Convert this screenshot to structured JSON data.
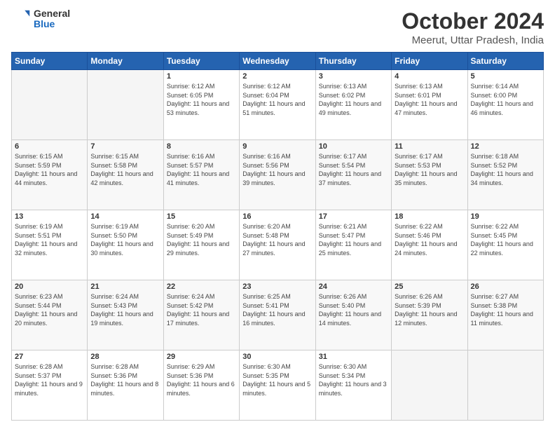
{
  "logo": {
    "general": "General",
    "blue": "Blue"
  },
  "title": "October 2024",
  "subtitle": "Meerut, Uttar Pradesh, India",
  "days_header": [
    "Sunday",
    "Monday",
    "Tuesday",
    "Wednesday",
    "Thursday",
    "Friday",
    "Saturday"
  ],
  "weeks": [
    [
      {
        "day": "",
        "sunrise": "",
        "sunset": "",
        "daylight": ""
      },
      {
        "day": "",
        "sunrise": "",
        "sunset": "",
        "daylight": ""
      },
      {
        "day": "1",
        "sunrise": "6:12 AM",
        "sunset": "6:05 PM",
        "daylight": "11 hours and 53 minutes."
      },
      {
        "day": "2",
        "sunrise": "6:12 AM",
        "sunset": "6:04 PM",
        "daylight": "11 hours and 51 minutes."
      },
      {
        "day": "3",
        "sunrise": "6:13 AM",
        "sunset": "6:02 PM",
        "daylight": "11 hours and 49 minutes."
      },
      {
        "day": "4",
        "sunrise": "6:13 AM",
        "sunset": "6:01 PM",
        "daylight": "11 hours and 47 minutes."
      },
      {
        "day": "5",
        "sunrise": "6:14 AM",
        "sunset": "6:00 PM",
        "daylight": "11 hours and 46 minutes."
      }
    ],
    [
      {
        "day": "6",
        "sunrise": "6:15 AM",
        "sunset": "5:59 PM",
        "daylight": "11 hours and 44 minutes."
      },
      {
        "day": "7",
        "sunrise": "6:15 AM",
        "sunset": "5:58 PM",
        "daylight": "11 hours and 42 minutes."
      },
      {
        "day": "8",
        "sunrise": "6:16 AM",
        "sunset": "5:57 PM",
        "daylight": "11 hours and 41 minutes."
      },
      {
        "day": "9",
        "sunrise": "6:16 AM",
        "sunset": "5:56 PM",
        "daylight": "11 hours and 39 minutes."
      },
      {
        "day": "10",
        "sunrise": "6:17 AM",
        "sunset": "5:54 PM",
        "daylight": "11 hours and 37 minutes."
      },
      {
        "day": "11",
        "sunrise": "6:17 AM",
        "sunset": "5:53 PM",
        "daylight": "11 hours and 35 minutes."
      },
      {
        "day": "12",
        "sunrise": "6:18 AM",
        "sunset": "5:52 PM",
        "daylight": "11 hours and 34 minutes."
      }
    ],
    [
      {
        "day": "13",
        "sunrise": "6:19 AM",
        "sunset": "5:51 PM",
        "daylight": "11 hours and 32 minutes."
      },
      {
        "day": "14",
        "sunrise": "6:19 AM",
        "sunset": "5:50 PM",
        "daylight": "11 hours and 30 minutes."
      },
      {
        "day": "15",
        "sunrise": "6:20 AM",
        "sunset": "5:49 PM",
        "daylight": "11 hours and 29 minutes."
      },
      {
        "day": "16",
        "sunrise": "6:20 AM",
        "sunset": "5:48 PM",
        "daylight": "11 hours and 27 minutes."
      },
      {
        "day": "17",
        "sunrise": "6:21 AM",
        "sunset": "5:47 PM",
        "daylight": "11 hours and 25 minutes."
      },
      {
        "day": "18",
        "sunrise": "6:22 AM",
        "sunset": "5:46 PM",
        "daylight": "11 hours and 24 minutes."
      },
      {
        "day": "19",
        "sunrise": "6:22 AM",
        "sunset": "5:45 PM",
        "daylight": "11 hours and 22 minutes."
      }
    ],
    [
      {
        "day": "20",
        "sunrise": "6:23 AM",
        "sunset": "5:44 PM",
        "daylight": "11 hours and 20 minutes."
      },
      {
        "day": "21",
        "sunrise": "6:24 AM",
        "sunset": "5:43 PM",
        "daylight": "11 hours and 19 minutes."
      },
      {
        "day": "22",
        "sunrise": "6:24 AM",
        "sunset": "5:42 PM",
        "daylight": "11 hours and 17 minutes."
      },
      {
        "day": "23",
        "sunrise": "6:25 AM",
        "sunset": "5:41 PM",
        "daylight": "11 hours and 16 minutes."
      },
      {
        "day": "24",
        "sunrise": "6:26 AM",
        "sunset": "5:40 PM",
        "daylight": "11 hours and 14 minutes."
      },
      {
        "day": "25",
        "sunrise": "6:26 AM",
        "sunset": "5:39 PM",
        "daylight": "11 hours and 12 minutes."
      },
      {
        "day": "26",
        "sunrise": "6:27 AM",
        "sunset": "5:38 PM",
        "daylight": "11 hours and 11 minutes."
      }
    ],
    [
      {
        "day": "27",
        "sunrise": "6:28 AM",
        "sunset": "5:37 PM",
        "daylight": "11 hours and 9 minutes."
      },
      {
        "day": "28",
        "sunrise": "6:28 AM",
        "sunset": "5:36 PM",
        "daylight": "11 hours and 8 minutes."
      },
      {
        "day": "29",
        "sunrise": "6:29 AM",
        "sunset": "5:36 PM",
        "daylight": "11 hours and 6 minutes."
      },
      {
        "day": "30",
        "sunrise": "6:30 AM",
        "sunset": "5:35 PM",
        "daylight": "11 hours and 5 minutes."
      },
      {
        "day": "31",
        "sunrise": "6:30 AM",
        "sunset": "5:34 PM",
        "daylight": "11 hours and 3 minutes."
      },
      {
        "day": "",
        "sunrise": "",
        "sunset": "",
        "daylight": ""
      },
      {
        "day": "",
        "sunrise": "",
        "sunset": "",
        "daylight": ""
      }
    ]
  ]
}
